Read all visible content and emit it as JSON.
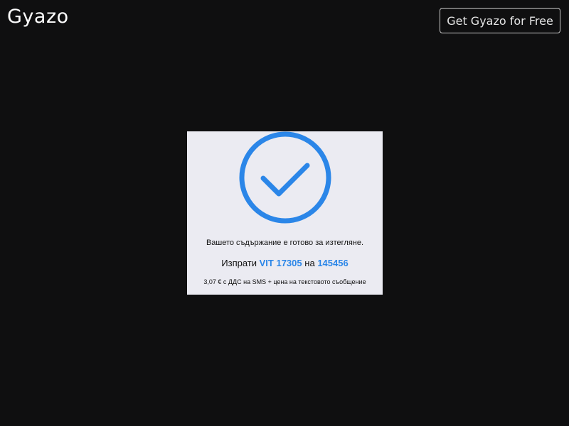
{
  "header": {
    "logo_text": "Gyazo",
    "cta_label": "Get Gyazo for Free"
  },
  "screenshot": {
    "icon": "check-circle-icon",
    "accent_color": "#2b86e8",
    "background_color": "#ebebf2",
    "message": "Вашето съдържание е готово за изтегляне.",
    "send_prefix": "Изпрати",
    "sms_code": "VIT 17305",
    "send_middle": "на",
    "short_number": "145456",
    "price_note": "3,07 € с ДДС на SMS + цена на текстовото съобщение"
  },
  "page": {
    "background_color": "#0f0f10"
  }
}
